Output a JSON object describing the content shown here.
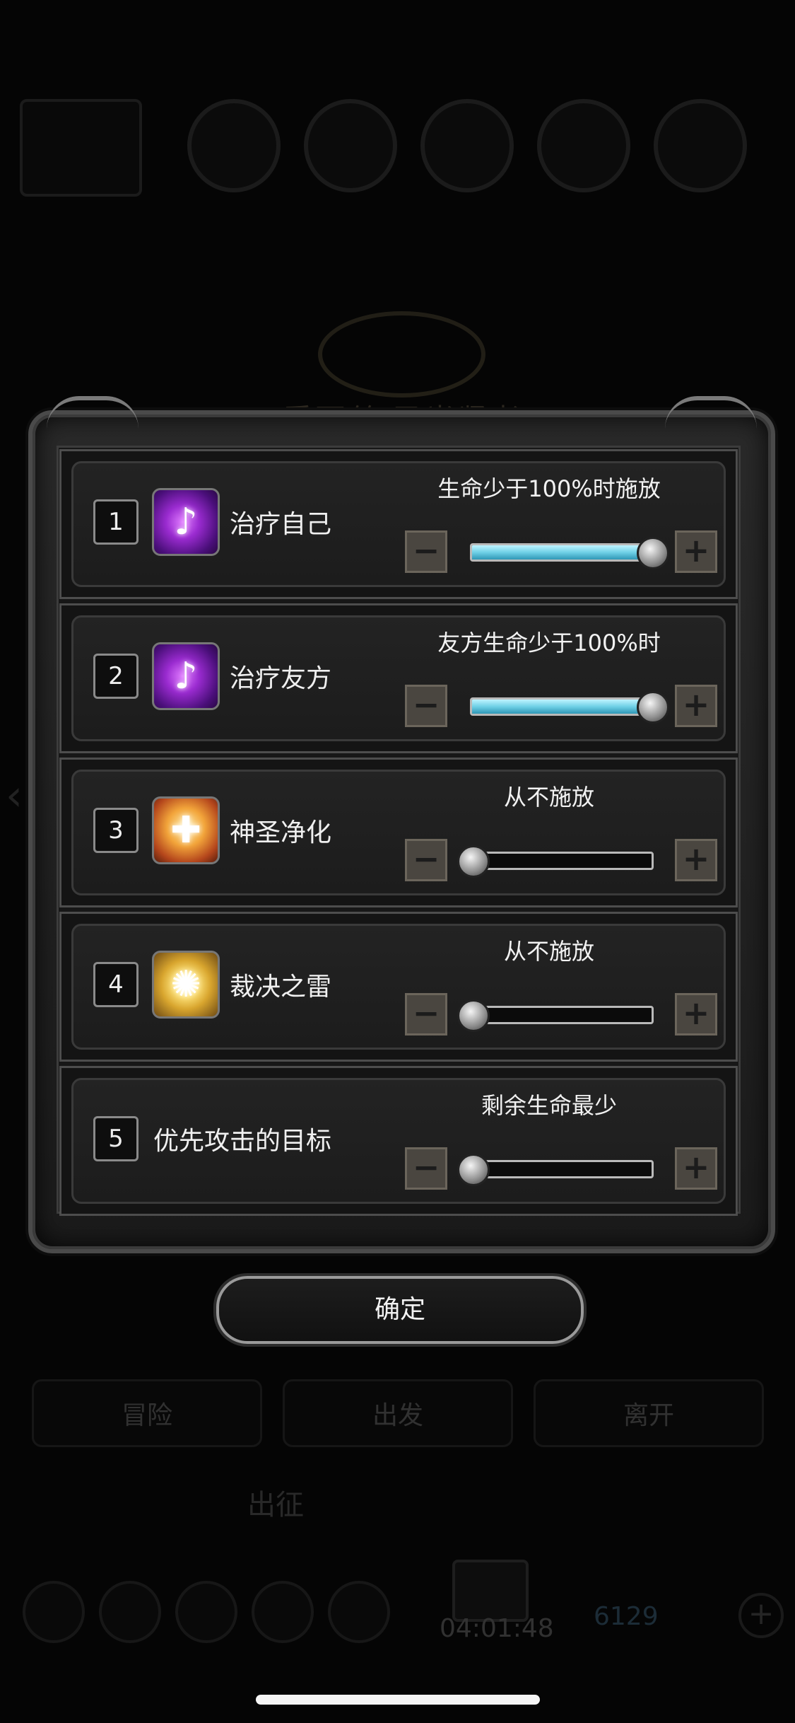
{
  "background": {
    "hero_title": "爱丽丝 圣光贤者",
    "bottom_tabs": [
      "冒险",
      "出发",
      "离开"
    ],
    "bottom_text": "出征",
    "timer": "04:01:48",
    "gem_count": "6129"
  },
  "rows": [
    {
      "num": "1",
      "name": "治疗自己",
      "condition": "生命少于100%时施放",
      "level": 1.0,
      "icon": "purple-heal-icon"
    },
    {
      "num": "2",
      "name": "治疗友方",
      "condition": "友方生命少于100%时",
      "level": 1.0,
      "icon": "purple-heal-icon"
    },
    {
      "num": "3",
      "name": "神圣净化",
      "condition": "从不施放",
      "level": 0.0,
      "icon": "holy-purify-icon"
    },
    {
      "num": "4",
      "name": "裁决之雷",
      "condition": "从不施放",
      "level": 0.0,
      "icon": "thunder-judgement-icon"
    },
    {
      "num": "5",
      "name": "优先攻击的目标",
      "condition": "剩余生命最少",
      "level": 0.0,
      "icon": ""
    }
  ],
  "confirm_label": "确定",
  "colors": {
    "slider_fill": "#6fd0e6",
    "panel": "#1c1c1c",
    "border": "#4d4d4d"
  }
}
